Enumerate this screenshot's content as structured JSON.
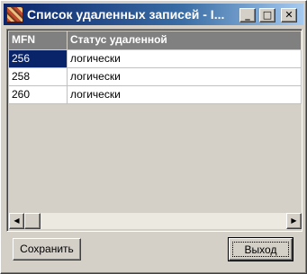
{
  "window": {
    "title": "Список удаленных записей - I...",
    "controls": {
      "minimize": "_",
      "maximize": "□",
      "close": "✕"
    }
  },
  "grid": {
    "columns": [
      "MFN",
      "Статус удаленной"
    ],
    "rows": [
      {
        "mfn": "256",
        "status": "логически",
        "selected": true
      },
      {
        "mfn": "258",
        "status": "логически",
        "selected": false
      },
      {
        "mfn": "260",
        "status": "логически",
        "selected": false
      }
    ],
    "scroll_left": "◀",
    "scroll_right": "▶"
  },
  "buttons": {
    "save": "Сохранить",
    "exit": "Выход"
  },
  "colors": {
    "selection": "#0a246a",
    "header_bg": "#808080",
    "face": "#d4d0c8"
  },
  "icons": {
    "app": "app-icon",
    "minimize": "minimize-icon",
    "maximize": "maximize-icon",
    "close": "close-icon"
  }
}
